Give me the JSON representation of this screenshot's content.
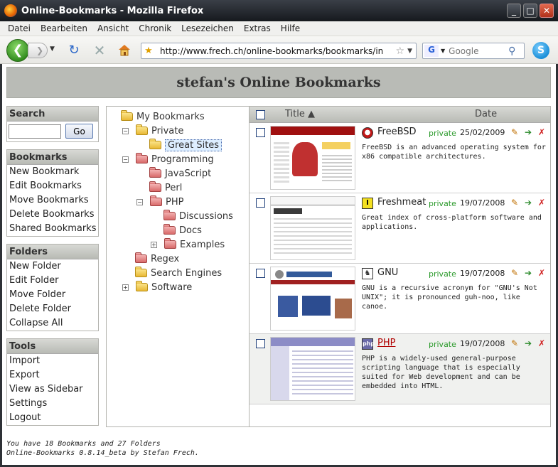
{
  "window": {
    "title": "Online-Bookmarks - Mozilla Firefox"
  },
  "menu": [
    "Datei",
    "Bearbeiten",
    "Ansicht",
    "Chronik",
    "Lesezeichen",
    "Extras",
    "Hilfe"
  ],
  "nav": {
    "url": "http://www.frech.ch/online-bookmarks/bookmarks/index.php",
    "search_placeholder": "Google",
    "search_engine": "G"
  },
  "page": {
    "title": "stefan's Online Bookmarks"
  },
  "sidebar": {
    "search": {
      "heading": "Search",
      "button": "Go",
      "value": ""
    },
    "bookmarks": {
      "heading": "Bookmarks",
      "items": [
        "New Bookmark",
        "Edit Bookmarks",
        "Move Bookmarks",
        "Delete Bookmarks",
        "Shared Bookmarks"
      ]
    },
    "folders": {
      "heading": "Folders",
      "items": [
        "New Folder",
        "Edit Folder",
        "Move Folder",
        "Delete Folder",
        "Collapse All"
      ]
    },
    "tools": {
      "heading": "Tools",
      "items": [
        "Import",
        "Export",
        "View as Sidebar",
        "Settings",
        "Logout"
      ]
    }
  },
  "tree": {
    "root": "My Bookmarks",
    "nodes": [
      {
        "label": "Private",
        "expander": "−",
        "color": "yellow"
      },
      {
        "label": "Great Sites",
        "color": "yellow",
        "selected": true
      },
      {
        "label": "Programming",
        "expander": "−",
        "color": "red"
      },
      {
        "label": "JavaScript",
        "color": "red"
      },
      {
        "label": "Perl",
        "color": "red"
      },
      {
        "label": "PHP",
        "expander": "−",
        "color": "red"
      },
      {
        "label": "Discussions",
        "color": "red"
      },
      {
        "label": "Docs",
        "color": "red"
      },
      {
        "label": "Examples",
        "expander": "+",
        "color": "red"
      },
      {
        "label": "Regex",
        "color": "red"
      },
      {
        "label": "Search Engines",
        "color": "yellow"
      },
      {
        "label": "Software",
        "expander": "+",
        "color": "yellow"
      }
    ]
  },
  "bookmarks": {
    "col_title": "Title ▲",
    "col_date": "Date",
    "rows": [
      {
        "title": "FreeBSD",
        "visibility": "private",
        "date": "25/02/2009",
        "icon": "freebsd-icon",
        "description": "FreeBSD is an advanced operating system for x86 compatible architectures."
      },
      {
        "title": "Freshmeat",
        "visibility": "private",
        "date": "19/07/2008",
        "icon": "freshmeat-icon",
        "description": "Great index of cross-platform software and applications."
      },
      {
        "title": "GNU",
        "visibility": "private",
        "date": "19/07/2008",
        "icon": "gnu-icon",
        "description": "GNU is a recursive acronym for \"GNU's Not UNIX\"; it is pronounced guh-noo, like canoe."
      },
      {
        "title": "PHP",
        "visibility": "private",
        "date": "19/07/2008",
        "icon": "php-icon",
        "description": "PHP is a widely-used general-purpose scripting language that is especially suited for Web development and can be embedded into HTML."
      }
    ]
  },
  "footer": {
    "line1": "You have 18 Bookmarks and 27 Folders",
    "line2": "Online-Bookmarks 0.8.14_beta by Stefan Frech."
  },
  "colors": {
    "header_bg": "#b9bbb6",
    "private_text": "#2a9a2a",
    "link_red": "#b00000"
  }
}
